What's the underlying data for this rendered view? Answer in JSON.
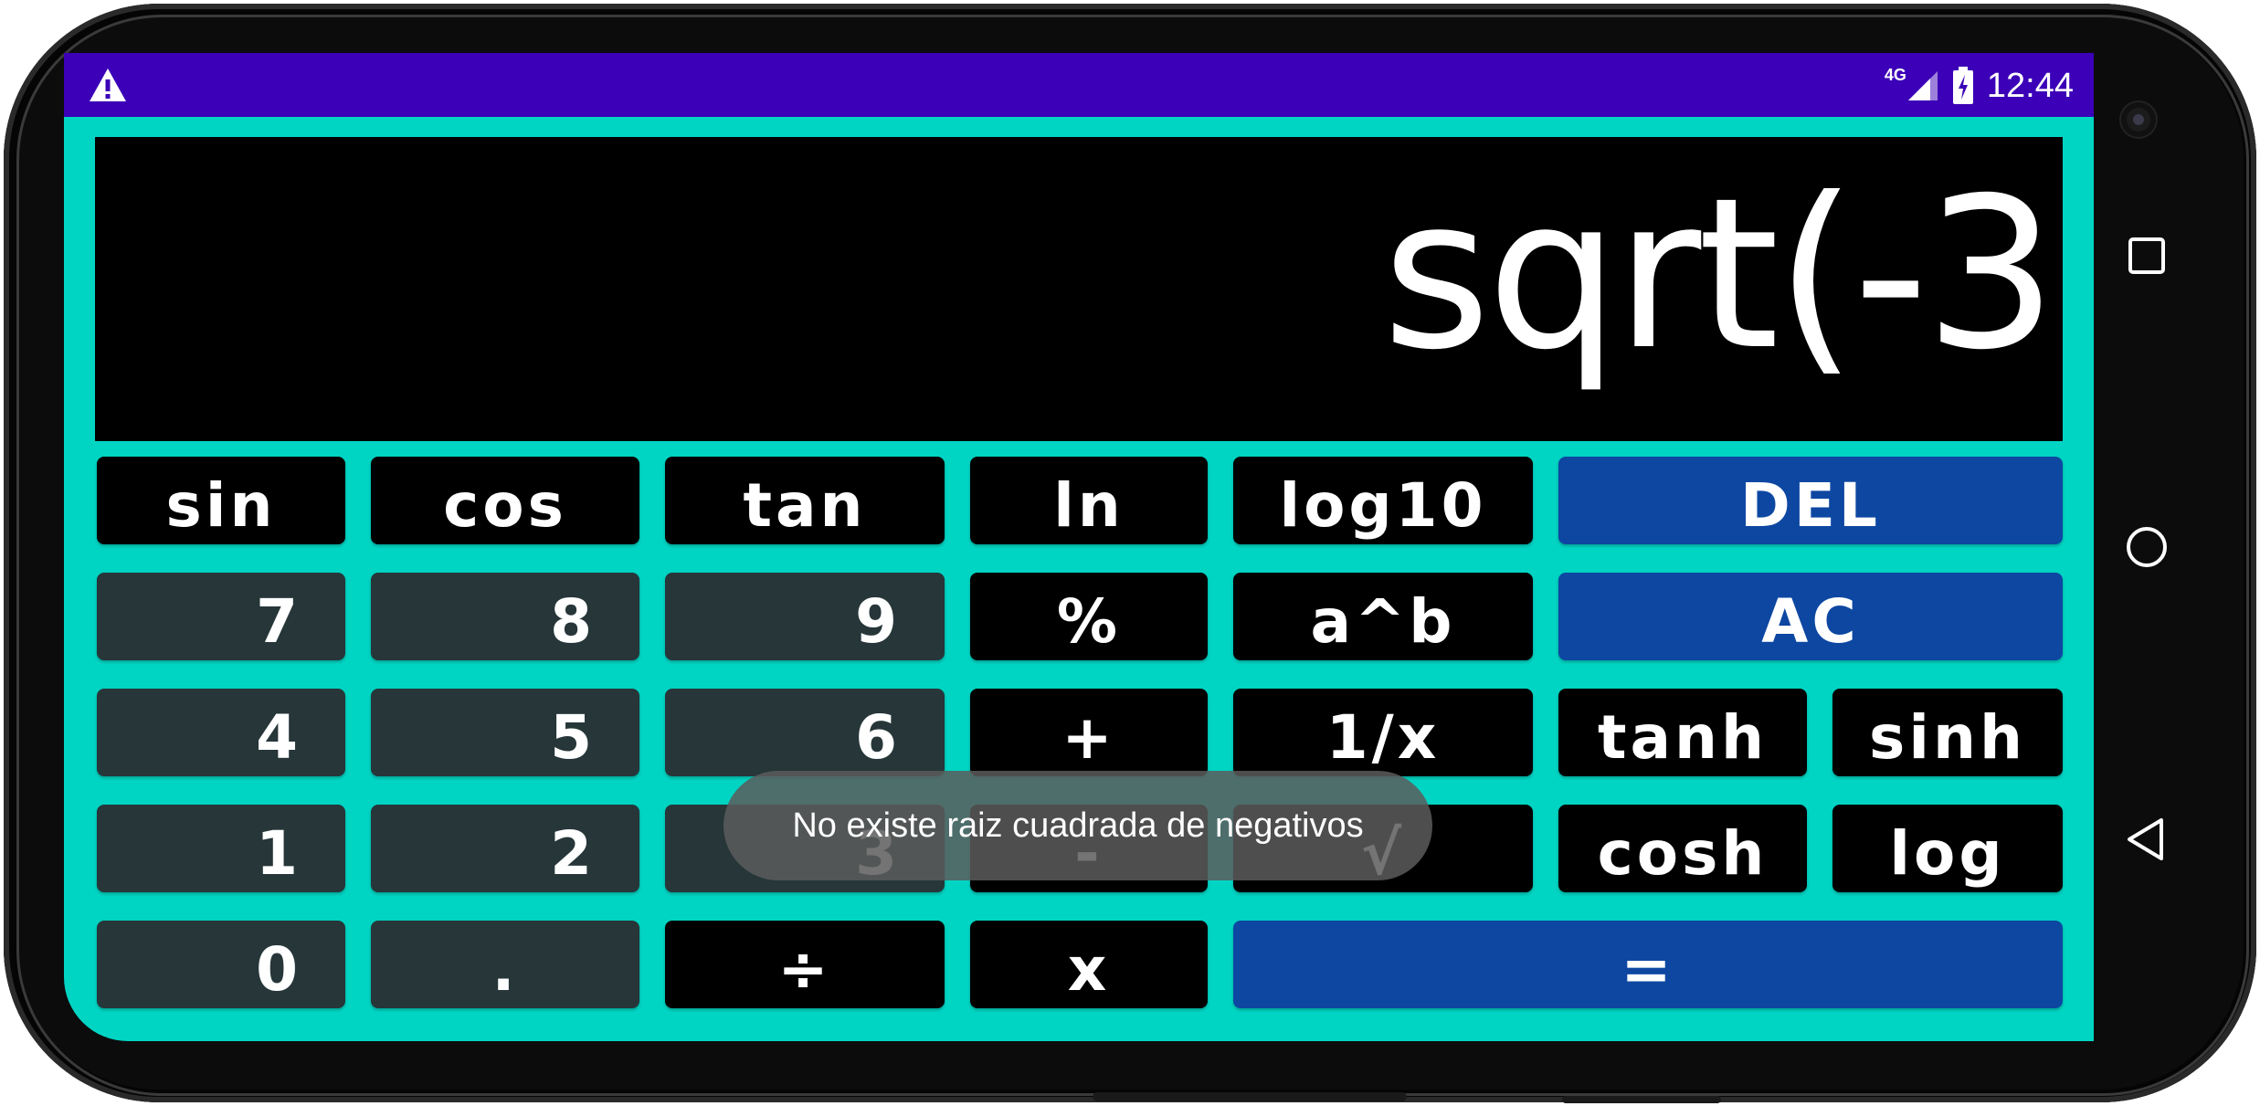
{
  "status_bar": {
    "network": "4G",
    "time": "12:44",
    "background_color": "#3b00b7"
  },
  "display": {
    "expression": "sqrt(-3"
  },
  "keys": {
    "sin": "sin",
    "cos": "cos",
    "tan": "tan",
    "ln": "ln",
    "log10": "log10",
    "del": "DEL",
    "seven": "7",
    "eight": "8",
    "nine": "9",
    "percent": "%",
    "power": "a^b",
    "ac": "AC",
    "four": "4",
    "five": "5",
    "six": "6",
    "plus": "+",
    "reciprocal": "1/x",
    "tanh": "tanh",
    "sinh": "sinh",
    "one": "1",
    "two": "2",
    "three": "3",
    "minus": "-",
    "sqrt": "√",
    "cosh": "cosh",
    "log": "log",
    "zero": "0",
    "dot": ".",
    "divide": "÷",
    "multiply": "x",
    "equals": "="
  },
  "toast": {
    "message": "No existe raiz cuadrada de negativos"
  },
  "colors": {
    "app_background": "#00d5c4",
    "function_key": "#000000",
    "number_key": "#263639",
    "action_key": "#0d47a1"
  },
  "icons": {
    "warning": "warning-icon",
    "signal": "signal-icon",
    "battery": "battery-charging-icon",
    "recents": "square-nav-icon",
    "home": "circle-nav-icon",
    "back": "triangle-back-icon"
  }
}
